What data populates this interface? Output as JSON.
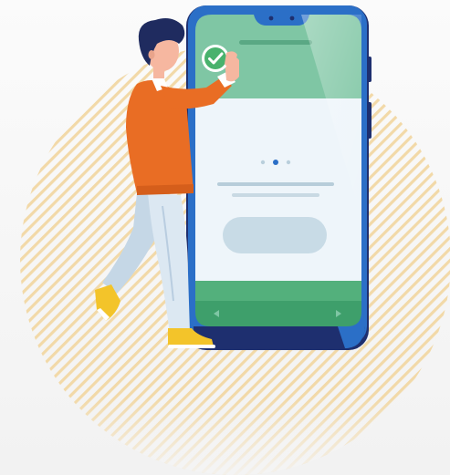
{
  "colors": {
    "background": "#f4f4f4",
    "stripe_circle": "#f2d9a8",
    "phone_body": "#2b6fc7",
    "phone_bezel_dark": "#1e2f6f",
    "screen_top": "#7fc6a4",
    "screen_body": "#eef5fa",
    "screen_bottom": "#3e9f6b",
    "button_pill": "#c8dbe6",
    "check_badge": "#49b26d",
    "shirt": "#e96d24",
    "pants": "#dce8f2",
    "hair": "#1f2b5f",
    "skin": "#f6b7a0",
    "shoes": "#f3c42a"
  },
  "icons": {
    "check": "check-icon",
    "nav_back": "chevron-left-icon",
    "nav_forward": "chevron-right-icon"
  },
  "carousel": {
    "active_index": 1,
    "count": 3
  }
}
